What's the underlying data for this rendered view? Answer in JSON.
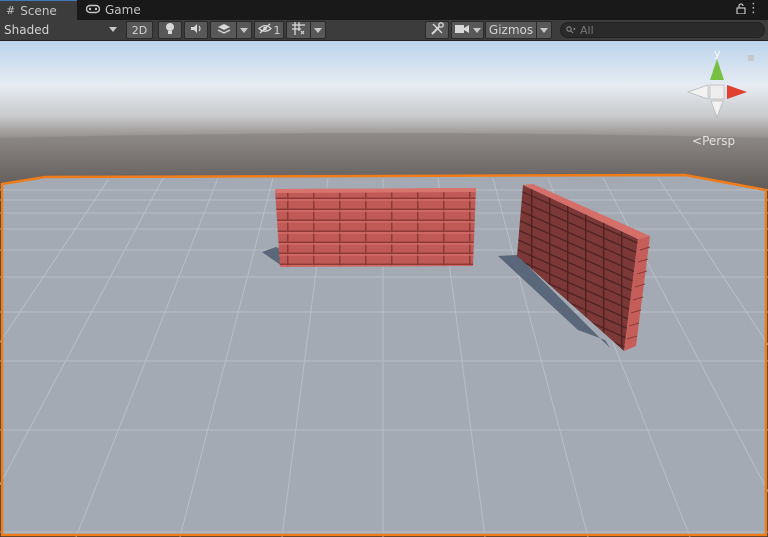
{
  "tabs": {
    "scene_label": "Scene",
    "game_label": "Game",
    "scene_icon": "grid-icon",
    "game_icon": "gamepad-icon"
  },
  "toolbar": {
    "draw_mode": "Shaded",
    "toggle_2d": "2D",
    "hidden_count": "1",
    "gizmos_label": "Gizmos",
    "search_placeholder": "All"
  },
  "viewport": {
    "projection_label": "Persp",
    "gizmo_axis_label": "y",
    "selection_outline_color": "#f07b19",
    "sky_color": "#d8e3f0",
    "ground_color": "#a3aab3",
    "brick_color": "#b84f4c"
  }
}
